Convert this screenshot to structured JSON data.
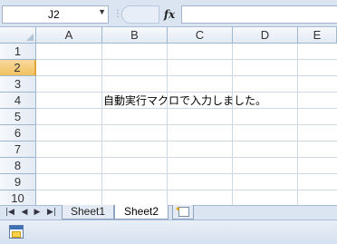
{
  "formula_bar": {
    "name_box": "J2",
    "fx_label": "fx",
    "formula": ""
  },
  "grid": {
    "columns": [
      "A",
      "B",
      "C",
      "D",
      "E"
    ],
    "rows": [
      "1",
      "2",
      "3",
      "4",
      "5",
      "6",
      "7",
      "8",
      "9",
      "10"
    ],
    "selected_row": "2",
    "cell_text": "自動実行マクロで入力しました。"
  },
  "sheets": {
    "tabs": [
      {
        "label": "Sheet1",
        "active": false
      },
      {
        "label": "Sheet2",
        "active": true
      }
    ]
  },
  "icons": {
    "nav": [
      "first-sheet-icon",
      "prev-sheet-icon",
      "next-sheet-icon",
      "last-sheet-icon"
    ],
    "new_sheet": "insert-sheet-icon",
    "status": "macro-record-icon"
  },
  "colors": {
    "selected_row_header": "#f1c15f",
    "frame": "#dbe5f1"
  }
}
